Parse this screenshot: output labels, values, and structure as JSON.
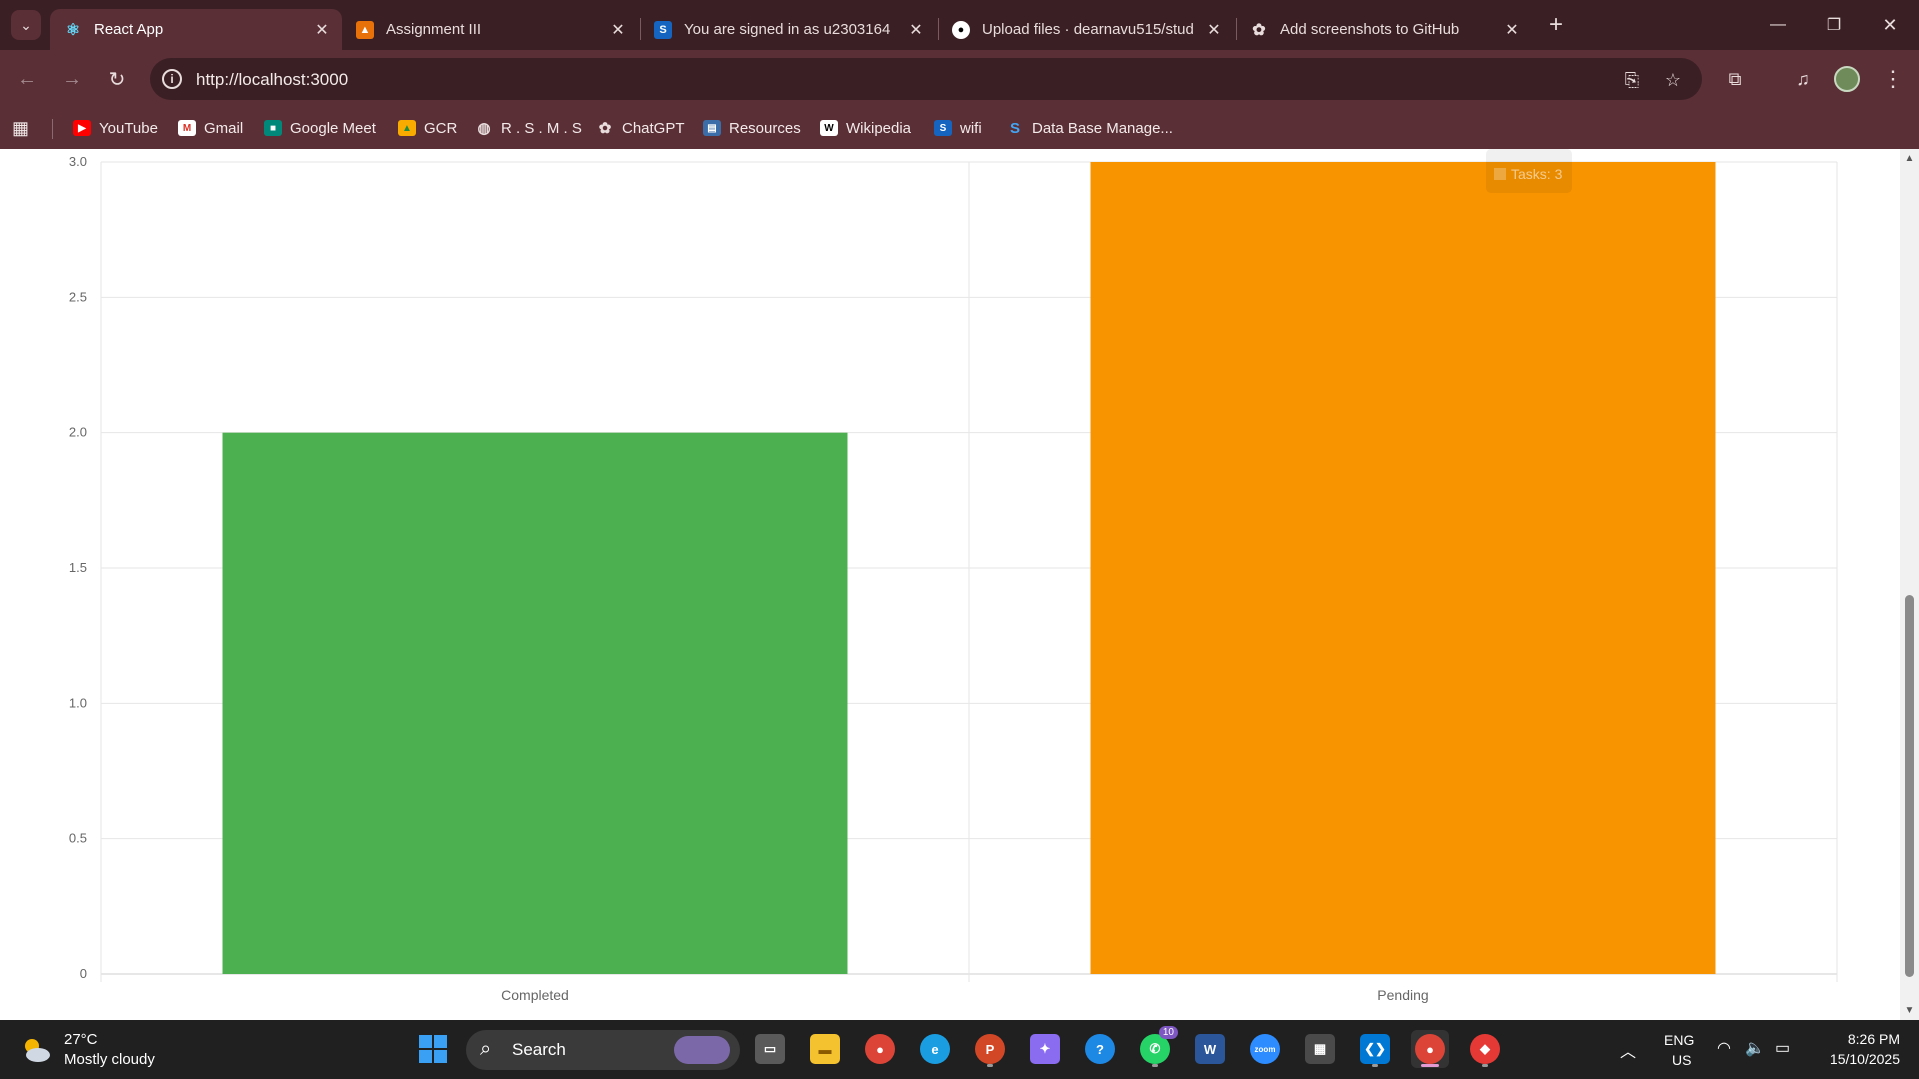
{
  "browser": {
    "tabs": [
      {
        "title": "React App",
        "icon": "react-icon",
        "active": true
      },
      {
        "title": "Assignment III",
        "icon": "classroom-icon",
        "active": false
      },
      {
        "title": "You are signed in as u2303164",
        "icon": "s-logo-icon",
        "active": false
      },
      {
        "title": "Upload files · dearnavu515/stud",
        "icon": "github-icon",
        "active": false
      },
      {
        "title": "Add screenshots to GitHub",
        "icon": "chatgpt-icon",
        "active": false
      }
    ],
    "url": "http://localhost:3000",
    "bookmarks": [
      {
        "label": "YouTube",
        "icon": "youtube-icon"
      },
      {
        "label": "Gmail",
        "icon": "gmail-icon"
      },
      {
        "label": "Google Meet",
        "icon": "meet-icon"
      },
      {
        "label": "GCR",
        "icon": "classroom-icon"
      },
      {
        "label": "R . S . M . S",
        "icon": "globe-icon"
      },
      {
        "label": "ChatGPT",
        "icon": "chatgpt-icon"
      },
      {
        "label": "Resources",
        "icon": "doc-icon"
      },
      {
        "label": "Wikipedia",
        "icon": "wikipedia-icon"
      },
      {
        "label": "wifi",
        "icon": "s-logo-icon"
      },
      {
        "label": "Data Base Manage...",
        "icon": "s-logo-icon"
      }
    ]
  },
  "chart_data": {
    "type": "bar",
    "categories": [
      "Completed",
      "Pending"
    ],
    "values": [
      2,
      3
    ],
    "colors": [
      "#4caf50",
      "#f79400"
    ],
    "ylim": [
      0,
      3
    ],
    "yticks": [
      "0",
      "0.5",
      "1.0",
      "1.5",
      "2.0",
      "2.5",
      "3.0"
    ],
    "grid": true,
    "tooltip": "Tasks: 3"
  },
  "taskbar": {
    "weather_temp": "27°C",
    "weather_desc": "Mostly cloudy",
    "search_label": "Search",
    "lang_top": "ENG",
    "lang_bottom": "US",
    "time": "8:26 PM",
    "date": "15/10/2025",
    "whatsapp_badge": "10"
  }
}
